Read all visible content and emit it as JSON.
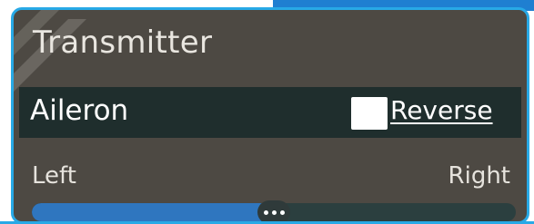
{
  "panel": {
    "title": "Transmitter",
    "accent_color": "#28a9e6",
    "background_color": "#4d4943"
  },
  "channel": {
    "label": "Aileron",
    "reverse": {
      "label": "Reverse",
      "checked": false
    }
  },
  "slider": {
    "left_label": "Left",
    "right_label": "Right",
    "value": 0.5,
    "fill_color": "#2f76bf",
    "thumb_icon": "grip-dots-icon"
  }
}
